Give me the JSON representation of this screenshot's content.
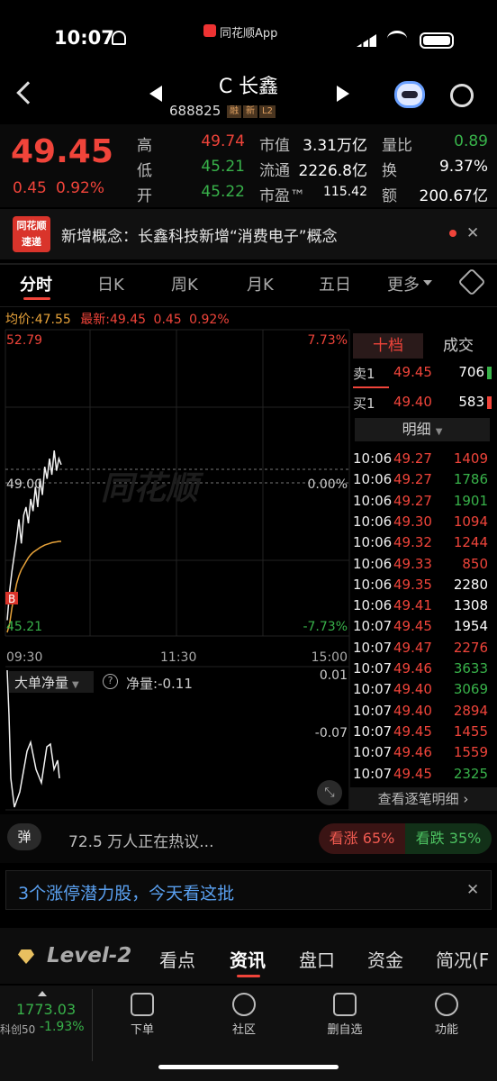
{
  "status_bar": {
    "time": "10:07",
    "app_name": "同花顺App"
  },
  "nav": {
    "title": "C 长鑫",
    "code": "688825",
    "tags": [
      "融",
      "新",
      "L2"
    ]
  },
  "quote": {
    "price": "49.45",
    "change": "0.45",
    "change_pct": "0.92%",
    "stats": [
      {
        "label": "高",
        "value": "49.74",
        "color": "red"
      },
      {
        "label": "低",
        "value": "45.21",
        "color": "green"
      },
      {
        "label": "开",
        "value": "45.22",
        "color": "green"
      }
    ],
    "stats2": [
      {
        "label": "市值",
        "value": "3.31万亿"
      },
      {
        "label": "流通",
        "value": "2226.8亿"
      },
      {
        "label": "市盈™",
        "value": "115.42"
      }
    ],
    "stats3": [
      {
        "label": "量比",
        "value": "0.89",
        "color": "green"
      },
      {
        "label": "换",
        "value": "9.37%"
      },
      {
        "label": "额",
        "value": "200.67亿"
      }
    ]
  },
  "news": {
    "badge_top": "同花顺",
    "badge_bottom": "速递",
    "text": "新增概念：长鑫科技新增“消费电子”概念"
  },
  "tabs": {
    "items": [
      "分时",
      "日K",
      "周K",
      "月K",
      "五日",
      "更多"
    ],
    "active": "分时"
  },
  "chart_info": {
    "avg_label": "均价:",
    "avg": "47.55",
    "latest_label": "最新:",
    "latest": "49.45",
    "chg": "0.45",
    "pct": "0.92%"
  },
  "chart": {
    "high_label": "52.79",
    "high_pct": "7.73%",
    "mid_label": "49.00",
    "mid_pct": "0.00%",
    "low_label": "45.21",
    "low_pct": "-7.73%",
    "times": [
      "09:30",
      "11:30",
      "15:00"
    ],
    "buy_marker": "B",
    "watermark": "同花顺"
  },
  "chart_data": {
    "type": "line",
    "series": [
      {
        "values": [
          45.6,
          46.3,
          46.8,
          47.2,
          47.6,
          48.1,
          47.5,
          48.2,
          48.4,
          48.0,
          48.6,
          48.3,
          48.9,
          48.4,
          49.1,
          48.7,
          49.4,
          49.1,
          49.6,
          49.2,
          49.8,
          49.3,
          49.6,
          49.45
        ]
      },
      {
        "values": [
          45.3,
          45.5,
          45.9,
          46.2,
          46.5,
          46.7,
          46.85,
          46.95,
          47.05,
          47.15,
          47.22,
          47.28,
          47.32,
          47.36,
          47.4,
          47.43,
          47.46,
          47.48,
          47.5,
          47.52,
          47.53,
          47.54,
          47.55,
          47.55
        ]
      }
    ],
    "ylim": [
      45.21,
      52.79
    ]
  },
  "flow": {
    "selector": "大单净量",
    "label": "净量:",
    "value": "-0.11",
    "top": "0.01",
    "mid": "-0.07"
  },
  "order_book": {
    "tab_active": "十档",
    "tab_other": "成交",
    "asks": [
      {
        "label": "卖1",
        "price": "49.45",
        "vol": "706"
      }
    ],
    "bids": [
      {
        "label": "买1",
        "price": "49.40",
        "vol": "583"
      }
    ],
    "detail_label": "明细"
  },
  "trades": [
    {
      "t": "10:06",
      "p": "49.27",
      "v": "1409",
      "dir": "red"
    },
    {
      "t": "10:06",
      "p": "49.27",
      "v": "1786",
      "dir": "green"
    },
    {
      "t": "10:06",
      "p": "49.27",
      "v": "1901",
      "dir": "green"
    },
    {
      "t": "10:06",
      "p": "49.30",
      "v": "1094",
      "dir": "red"
    },
    {
      "t": "10:06",
      "p": "49.32",
      "v": "1244",
      "dir": "red"
    },
    {
      "t": "10:06",
      "p": "49.33",
      "v": "850",
      "dir": "red"
    },
    {
      "t": "10:06",
      "p": "49.35",
      "v": "2280",
      "dir": "white"
    },
    {
      "t": "10:06",
      "p": "49.41",
      "v": "1308",
      "dir": "white"
    },
    {
      "t": "10:07",
      "p": "49.45",
      "v": "1954",
      "dir": "white"
    },
    {
      "t": "10:07",
      "p": "49.47",
      "v": "2276",
      "dir": "red"
    },
    {
      "t": "10:07",
      "p": "49.46",
      "v": "3633",
      "dir": "green"
    },
    {
      "t": "10:07",
      "p": "49.40",
      "v": "3069",
      "dir": "green"
    },
    {
      "t": "10:07",
      "p": "49.40",
      "v": "2894",
      "dir": "red"
    },
    {
      "t": "10:07",
      "p": "49.45",
      "v": "1455",
      "dir": "red"
    },
    {
      "t": "10:07",
      "p": "49.46",
      "v": "1559",
      "dir": "red"
    },
    {
      "t": "10:07",
      "p": "49.45",
      "v": "2325",
      "dir": "green"
    }
  ],
  "view_detail": "查看逐笔明细",
  "discussion": {
    "icon_text": "弹",
    "text": "72.5 万人正在热议...",
    "up": "看涨 65%",
    "down": "看跌 35%"
  },
  "promo": {
    "text": "3个涨停潜力股，今天看这批"
  },
  "bottom_tabs": {
    "level": "Level-2",
    "items": [
      "看点",
      "资讯",
      "盘口",
      "资金",
      "简况(F"
    ],
    "active": "资讯"
  },
  "index": {
    "value": "1773.03",
    "name": "科创50",
    "pct": "-1.93%"
  },
  "toolbar": [
    "下单",
    "社区",
    "删自选",
    "功能"
  ]
}
